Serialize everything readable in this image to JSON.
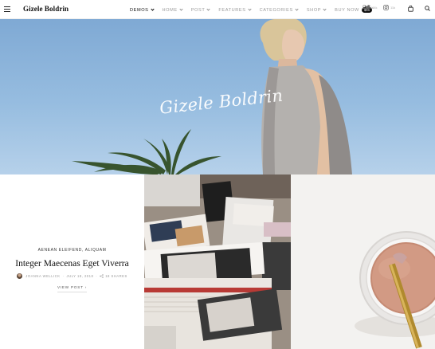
{
  "header": {
    "logo": "Gizele Boldrin",
    "nav": [
      {
        "label": "DEMOS",
        "active": true,
        "chevron": true
      },
      {
        "label": "HOME",
        "active": false,
        "chevron": true
      },
      {
        "label": "POST",
        "active": false,
        "chevron": true
      },
      {
        "label": "FEATURES",
        "active": false,
        "chevron": true
      },
      {
        "label": "CATEGORIES",
        "active": false,
        "chevron": true
      },
      {
        "label": "SHOP",
        "active": false,
        "chevron": true
      },
      {
        "label": "BUY NOW",
        "active": false,
        "chevron": false
      }
    ],
    "buy_badge": "$59",
    "social": [
      {
        "icon": "person-icon",
        "count": "44k"
      },
      {
        "icon": "twitter-icon",
        "count": "44k"
      },
      {
        "icon": "instagram-icon",
        "count": "11k"
      }
    ],
    "icons": [
      "cart-icon",
      "search-icon"
    ]
  },
  "hero": {
    "title": "Gizele Boldrin"
  },
  "post": {
    "categories": [
      "AENEAN ELEIFEND",
      "ALIQUAM"
    ],
    "title": "Integer Maecenas Eget Viverra",
    "author": "JOANNA WELLICK",
    "date": "JULY 18, 2018",
    "shares": "18 SHARES",
    "view_label": "VIEW POST"
  },
  "colors": {
    "sky": "#97bde0",
    "text": "#111111",
    "muted": "#999999"
  }
}
